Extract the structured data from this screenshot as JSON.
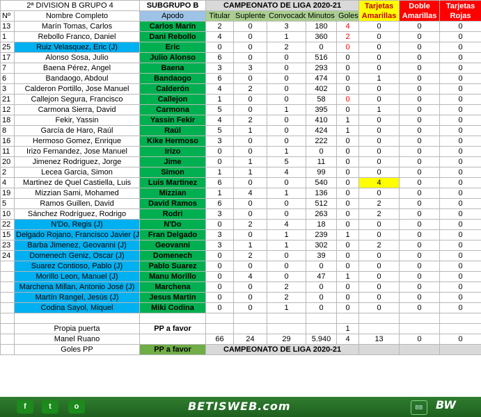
{
  "header": {
    "group": "2ª DIVISION B GRUPO 4",
    "subgroup": "SUBGRUPO B",
    "campeonato": "CAMPEONATO  DE LIGA 2020-21",
    "tarjetas_amarillas": "Tarjetas Amarillas",
    "doble_amarillas": "Doble Amarillas",
    "tarjetas_rojas": "Tarjetas Rojas"
  },
  "columns": {
    "num": "Nº",
    "nombre": "Nombre Completo",
    "apodo": "Apodo",
    "titular": "Titular",
    "suplente": "Suplente",
    "convocado": "Convocado",
    "minutos": "Minutos",
    "goles": "Goles"
  },
  "players": [
    {
      "num": "13",
      "name": "Marín Tomas, Carlos",
      "apodo": "Carlos Marín",
      "tit": "2",
      "sup": "0",
      "conv": "3",
      "min": "180",
      "goles": "4",
      "ta": "0",
      "da": "0",
      "tr": "0"
    },
    {
      "num": "1",
      "name": "Rebollo Franco, Daniel",
      "apodo": "Dani Rebollo",
      "tit": "4",
      "sup": "0",
      "conv": "1",
      "min": "360",
      "goles": "2",
      "ta": "0",
      "da": "0",
      "tr": "0"
    },
    {
      "num": "25",
      "name": "Ruiz Velasquez, Eric   (J)",
      "apodo": "Eric",
      "tit": "0",
      "sup": "0",
      "conv": "2",
      "min": "0",
      "goles": "0",
      "ta": "0",
      "da": "0",
      "tr": "0"
    },
    {
      "num": "17",
      "name": "Alonso Sosa, Julio",
      "apodo": "Julio Alonso",
      "tit": "6",
      "sup": "0",
      "conv": "0",
      "min": "516",
      "goles": "0",
      "ta": "0",
      "da": "0",
      "tr": "0"
    },
    {
      "num": "7",
      "name": "Baena Pérez, Angel",
      "apodo": "Baena",
      "tit": "3",
      "sup": "3",
      "conv": "0",
      "min": "293",
      "goles": "0",
      "ta": "0",
      "da": "0",
      "tr": "0"
    },
    {
      "num": "6",
      "name": "Bandaogo, Abdoul",
      "apodo": "Bandaogo",
      "tit": "6",
      "sup": "0",
      "conv": "0",
      "min": "474",
      "goles": "0",
      "ta": "1",
      "da": "0",
      "tr": "0"
    },
    {
      "num": "3",
      "name": "Calderon Portillo, Jose Manuel",
      "apodo": "Calderón",
      "tit": "4",
      "sup": "2",
      "conv": "0",
      "min": "402",
      "goles": "0",
      "ta": "0",
      "da": "0",
      "tr": "0"
    },
    {
      "num": "21",
      "name": "Callejon Segura, Francisco",
      "apodo": "Callejon",
      "tit": "1",
      "sup": "0",
      "conv": "0",
      "min": "58",
      "goles": "0",
      "ta": "0",
      "da": "0",
      "tr": "0"
    },
    {
      "num": "12",
      "name": "Carmona Sierra, David",
      "apodo": "Carmona",
      "tit": "5",
      "sup": "0",
      "conv": "1",
      "min": "395",
      "goles": "0",
      "ta": "1",
      "da": "0",
      "tr": "0"
    },
    {
      "num": "18",
      "name": "Fekir, Yassin",
      "apodo": "Yassin Fekir",
      "tit": "4",
      "sup": "2",
      "conv": "0",
      "min": "410",
      "goles": "1",
      "ta": "0",
      "da": "0",
      "tr": "0"
    },
    {
      "num": "8",
      "name": "García de Haro, Raúl",
      "apodo": "Raúl",
      "tit": "5",
      "sup": "1",
      "conv": "0",
      "min": "424",
      "goles": "1",
      "ta": "0",
      "da": "0",
      "tr": "0"
    },
    {
      "num": "16",
      "name": "Hermoso Gomez, Enrique",
      "apodo": "Kike Hermoso",
      "tit": "3",
      "sup": "0",
      "conv": "0",
      "min": "222",
      "goles": "0",
      "ta": "0",
      "da": "0",
      "tr": "0"
    },
    {
      "num": "11",
      "name": "Irizo Fernandez, Jose Manuel",
      "apodo": "Irizo",
      "tit": "0",
      "sup": "0",
      "conv": "1",
      "min": "0",
      "goles": "0",
      "ta": "0",
      "da": "0",
      "tr": "0"
    },
    {
      "num": "20",
      "name": "Jimenez Rodriguez, Jorge",
      "apodo": "Jime",
      "tit": "0",
      "sup": "1",
      "conv": "5",
      "min": "11",
      "goles": "0",
      "ta": "0",
      "da": "0",
      "tr": "0"
    },
    {
      "num": "2",
      "name": "Lecea Garcia, Simon",
      "apodo": "Simon",
      "tit": "1",
      "sup": "1",
      "conv": "4",
      "min": "99",
      "goles": "0",
      "ta": "0",
      "da": "0",
      "tr": "0"
    },
    {
      "num": "4",
      "name": "Martinez de Quel Castiella, Luis",
      "apodo": "Luis Martinez",
      "tit": "6",
      "sup": "0",
      "conv": "0",
      "min": "540",
      "goles": "0",
      "ta": "4",
      "da": "0",
      "tr": "0"
    },
    {
      "num": "19",
      "name": "Mizzian Sami, Mohamed",
      "apodo": "Mizzian",
      "tit": "1",
      "sup": "4",
      "conv": "1",
      "min": "136",
      "goles": "0",
      "ta": "0",
      "da": "0",
      "tr": "0"
    },
    {
      "num": "5",
      "name": "Ramos Guillen, David",
      "apodo": "David Ramos",
      "tit": "6",
      "sup": "0",
      "conv": "0",
      "min": "512",
      "goles": "0",
      "ta": "2",
      "da": "0",
      "tr": "0"
    },
    {
      "num": "10",
      "name": "Sánchez Rodríguez, Rodrigo",
      "apodo": "Rodri",
      "tit": "3",
      "sup": "0",
      "conv": "0",
      "min": "263",
      "goles": "0",
      "ta": "2",
      "da": "0",
      "tr": "0"
    },
    {
      "num": "22",
      "name": "N'Do, Regis (J)",
      "apodo": "N'Do",
      "tit": "0",
      "sup": "2",
      "conv": "4",
      "min": "18",
      "goles": "0",
      "ta": "0",
      "da": "0",
      "tr": "0"
    },
    {
      "num": "15",
      "name": "Delgado Rojano, Francisco Javier (J)",
      "apodo": "Fran Delgado",
      "tit": "3",
      "sup": "0",
      "conv": "1",
      "min": "239",
      "goles": "1",
      "ta": "0",
      "da": "0",
      "tr": "0"
    },
    {
      "num": "23",
      "name": "Barba Jimenez, Geovanni (J)",
      "apodo": "Geovanni",
      "tit": "3",
      "sup": "1",
      "conv": "1",
      "min": "302",
      "goles": "0",
      "ta": "2",
      "da": "0",
      "tr": "0"
    },
    {
      "num": "24",
      "name": "Domenech Geniz, Oscar (J)",
      "apodo": "Domenech",
      "tit": "0",
      "sup": "2",
      "conv": "0",
      "min": "39",
      "goles": "0",
      "ta": "0",
      "da": "0",
      "tr": "0"
    },
    {
      "num": "",
      "name": "Suarez Contioso, Pablo (J)",
      "apodo": "Pablo Suarez",
      "tit": "0",
      "sup": "0",
      "conv": "0",
      "min": "0",
      "goles": "0",
      "ta": "0",
      "da": "0",
      "tr": "0"
    },
    {
      "num": "",
      "name": "Morillo Leon, Manuel (J)",
      "apodo": "Manu Morillo",
      "tit": "0",
      "sup": "4",
      "conv": "0",
      "min": "47",
      "goles": "1",
      "ta": "0",
      "da": "0",
      "tr": "0"
    },
    {
      "num": "",
      "name": "Marchena Millan, Antonio José (J)",
      "apodo": "Marchena",
      "tit": "0",
      "sup": "0",
      "conv": "2",
      "min": "0",
      "goles": "0",
      "ta": "0",
      "da": "0",
      "tr": "0"
    },
    {
      "num": "",
      "name": "Martín Rangel, Jesús (J)",
      "apodo": "Jesus Martin",
      "tit": "0",
      "sup": "0",
      "conv": "2",
      "min": "0",
      "goles": "0",
      "ta": "0",
      "da": "0",
      "tr": "0"
    },
    {
      "num": "",
      "name": "Codina Sayol, Miquel",
      "apodo": "Miki Codina",
      "tit": "0",
      "sup": "0",
      "conv": "1",
      "min": "0",
      "goles": "0",
      "ta": "0",
      "da": "0",
      "tr": "0"
    }
  ],
  "propia_puerta": {
    "label": "Propia puerta",
    "apodo": "PP a favor",
    "goles": "1"
  },
  "totals": {
    "label": "Manel Ruano",
    "tit": "66",
    "sup": "24",
    "conv": "29",
    "min": "5.940",
    "goles": "4",
    "ta": "13",
    "da": "0",
    "tr": "0"
  },
  "goles_pp": {
    "label": "Goles PP",
    "apodo": "PP a favor",
    "campeonato": "CAMPEONATO  DE LIGA 2020-21"
  },
  "footer": {
    "brand": "BETISWEB.com",
    "social": [
      "f",
      "t",
      "o"
    ],
    "social_icons": [
      "facebook-icon",
      "twitter-icon",
      "instagram-icon"
    ],
    "logo_small": "BB",
    "logo_right": "BW"
  }
}
